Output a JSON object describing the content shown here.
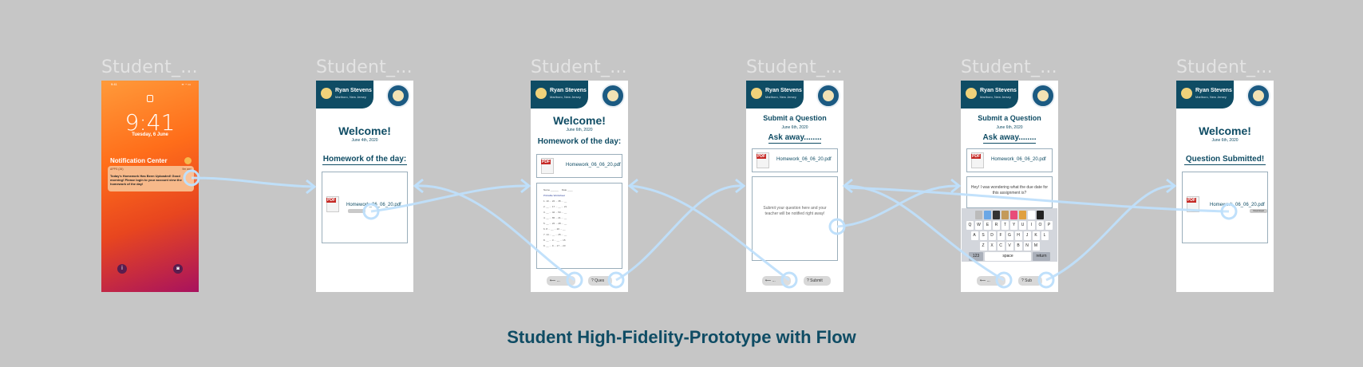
{
  "frames": [
    {
      "label": "Student_..."
    },
    {
      "label": "Student_..."
    },
    {
      "label": "Student_..."
    },
    {
      "label": "Student_..."
    },
    {
      "label": "Student_..."
    },
    {
      "label": "Student_..."
    }
  ],
  "lock_screen": {
    "status_time": "9:41",
    "time": "9:41",
    "date": "Tuesday, 6 June",
    "notification_center": "Notification Center",
    "notification_app": "APPS (26)",
    "notification_time": "9m ago",
    "notification_text": "Today's Homework Has Been Uploaded! Good morning! Please login to your account view the homework of the day!"
  },
  "header": {
    "name": "Ryan Stevens",
    "location": "Marlboro, New Jersey"
  },
  "screen2": {
    "welcome": "Welcome!",
    "date": "June 4th, 2020",
    "homework_title": "Homework of the day:",
    "file": "Homework_06_06_20.pdf"
  },
  "screen3": {
    "welcome": "Welcome!",
    "date": "June 6th, 2020",
    "homework_title": "Homework of the day:",
    "file": "Homework_06_06_20.pdf",
    "back": "...",
    "question": "Ques"
  },
  "screen4": {
    "title": "Submit a Question",
    "date": "June 6th, 2020",
    "ask": "Ask away........",
    "file": "Homework_06_06_20.pdf",
    "placeholder": "Submit your question here and your teacher will be notified right away!",
    "back": "...",
    "submit": "Submit"
  },
  "screen5": {
    "title": "Submit a Question",
    "date": "June 6th, 2020",
    "ask": "Ask away........",
    "file": "Homework_06_06_20.pdf",
    "typed": "Hey! I was wondering what the due date for this assignment is?",
    "back": "...",
    "submit": "Sub"
  },
  "screen6": {
    "welcome": "Welcome!",
    "date": "June 6th, 2020",
    "submitted": "Question Submitted!",
    "file": "Homework_06_06_20.pdf",
    "download": "Download"
  },
  "keyboard": {
    "row1": [
      "Q",
      "W",
      "E",
      "R",
      "T",
      "Y",
      "U",
      "I",
      "O",
      "P"
    ],
    "row2": [
      "A",
      "S",
      "D",
      "F",
      "G",
      "H",
      "J",
      "K",
      "L"
    ],
    "row3": [
      "Z",
      "X",
      "C",
      "V",
      "B",
      "N",
      "M"
    ],
    "space": "space",
    "return": "return",
    "num": "123"
  },
  "page_title": "Student High-Fidelity-Prototype with Flow",
  "colors": {
    "brand": "#0f4c64",
    "wire": "#bfe0fb",
    "canvas": "#c6c6c6"
  }
}
